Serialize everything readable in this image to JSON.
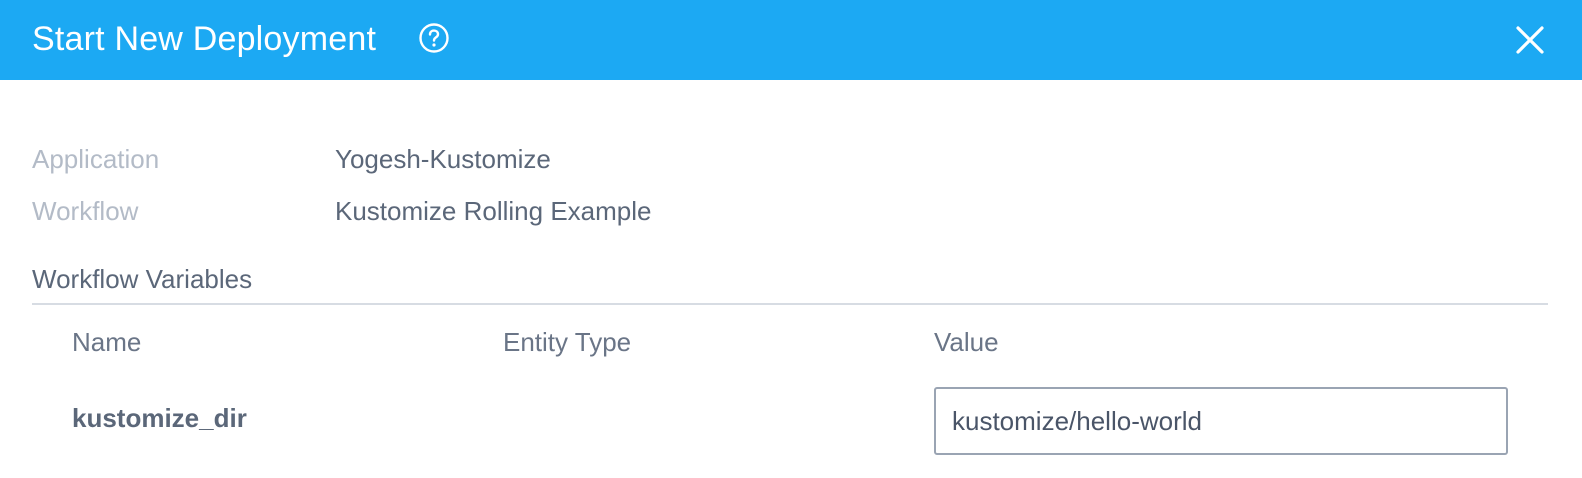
{
  "header": {
    "title": "Start New Deployment",
    "help_icon": "question-circle-icon",
    "close_icon": "close-icon",
    "background_color": "#1ca9f3"
  },
  "info": {
    "application_label": "Application",
    "application_value": "Yogesh-Kustomize",
    "workflow_label": "Workflow",
    "workflow_value": "Kustomize Rolling Example"
  },
  "variables": {
    "section_title": "Workflow Variables",
    "columns": [
      "Name",
      "Entity Type",
      "Value"
    ],
    "rows": [
      {
        "name": "kustomize_dir",
        "entity_type": "",
        "value": "kustomize/hello-world"
      }
    ]
  }
}
